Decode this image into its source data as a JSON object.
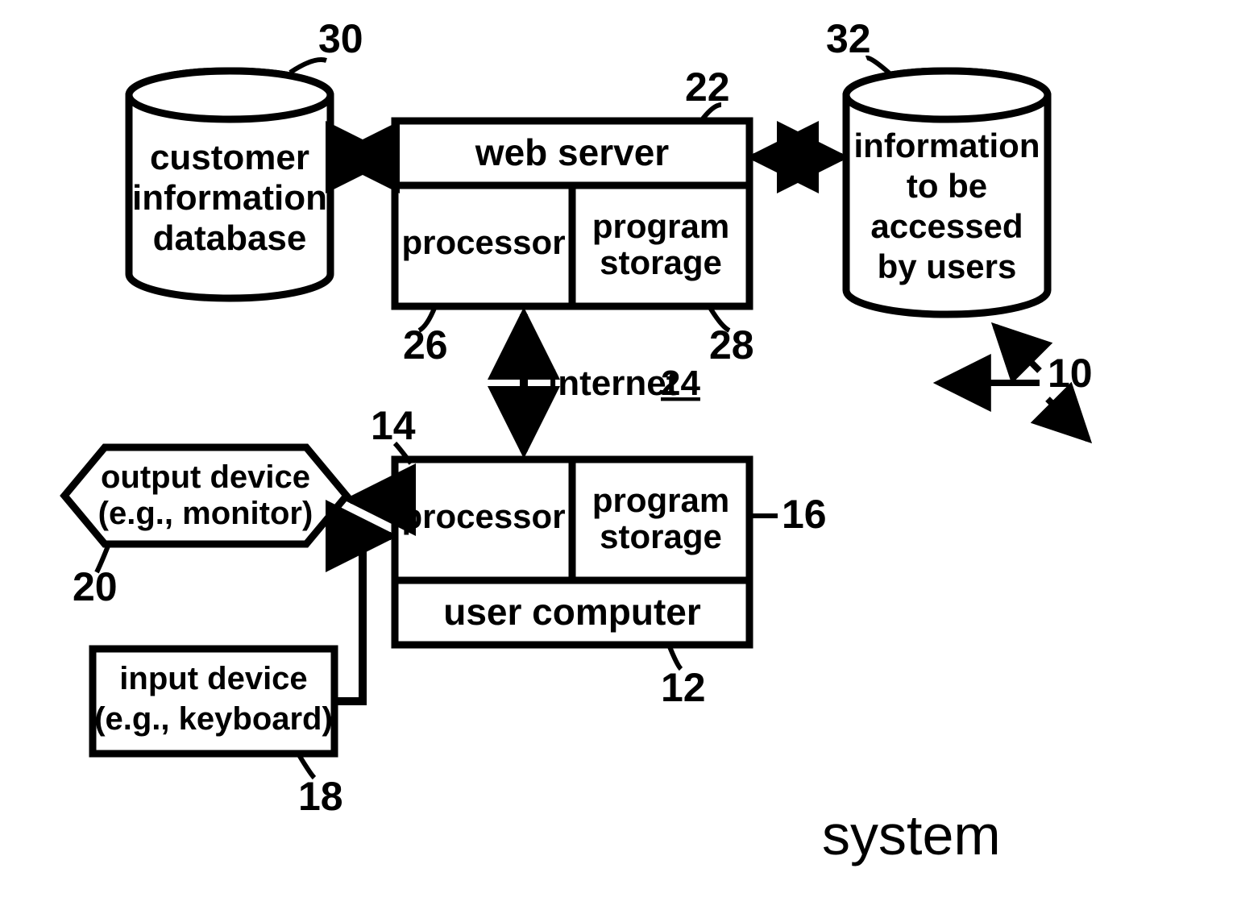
{
  "nodes": {
    "db_customer": {
      "ref": "30",
      "lines": [
        "customer",
        "information",
        "database"
      ]
    },
    "db_info": {
      "ref": "32",
      "lines": [
        "information",
        "to be",
        "accessed",
        "by users"
      ]
    },
    "web_server": {
      "ref": "22",
      "label": "web server",
      "processor": {
        "ref": "26",
        "label": "processor"
      },
      "storage": {
        "ref": "28",
        "lines": [
          "program",
          "storage"
        ]
      }
    },
    "internet": {
      "ref": "24",
      "label": "internet"
    },
    "user_computer": {
      "ref": "12",
      "label": "user computer",
      "processor": {
        "ref": "14",
        "label": "processor"
      },
      "storage": {
        "ref": "16",
        "lines": [
          "program",
          "storage"
        ]
      }
    },
    "output_device": {
      "ref": "20",
      "lines": [
        "output device",
        "(e.g., monitor)"
      ]
    },
    "input_device": {
      "ref": "18",
      "lines": [
        "input device",
        "(e.g., keyboard)"
      ]
    },
    "system": {
      "ref": "10",
      "label": "system"
    }
  }
}
